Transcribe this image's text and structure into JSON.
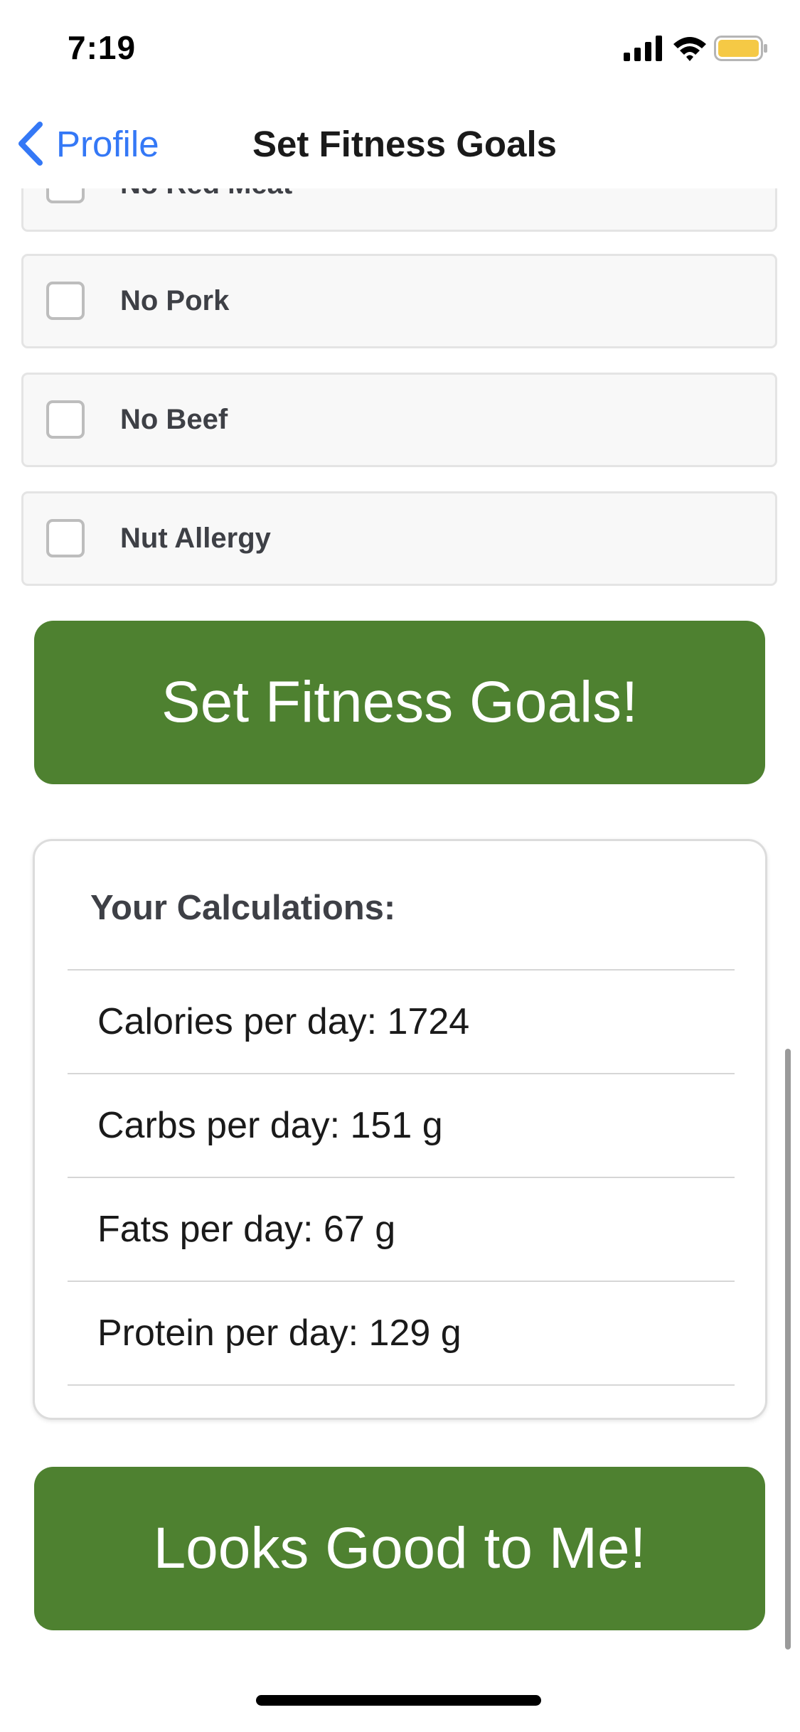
{
  "status_bar": {
    "time": "7:19",
    "icons": [
      "signal-icon",
      "wifi-icon",
      "battery-icon"
    ],
    "battery_color": "#f5c945"
  },
  "nav": {
    "back_label": "Profile",
    "title": "Set Fitness Goals"
  },
  "diet_options": [
    {
      "label": "No Red Meat",
      "checked": false
    },
    {
      "label": "No Pork",
      "checked": false
    },
    {
      "label": "No Beef",
      "checked": false
    },
    {
      "label": "Nut Allergy",
      "checked": false
    }
  ],
  "actions": {
    "set_goals_label": "Set Fitness Goals!",
    "confirm_label": "Looks Good to Me!"
  },
  "calculations": {
    "title": "Your Calculations:",
    "items": [
      {
        "label": "Calories per day: 1724"
      },
      {
        "label": "Carbs per day: 151 g"
      },
      {
        "label": "Fats per day: 67 g"
      },
      {
        "label": "Protein per day: 129 g"
      }
    ]
  },
  "colors": {
    "accent_green": "#4e8130",
    "link_blue": "#3478f6"
  }
}
